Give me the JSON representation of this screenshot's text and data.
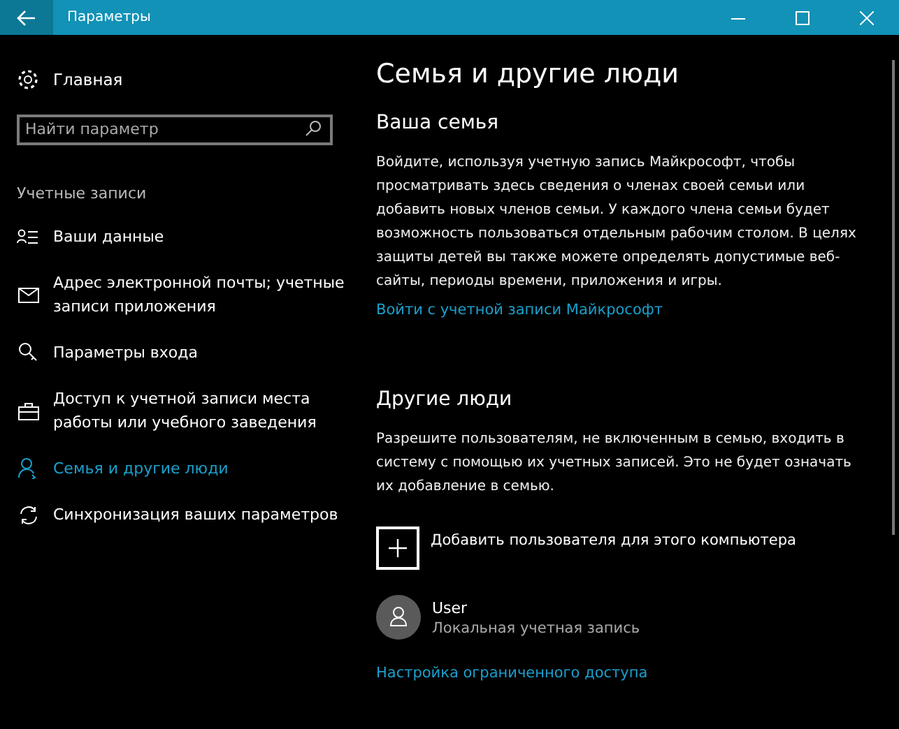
{
  "window": {
    "title": "Параметры"
  },
  "sidebar": {
    "home": "Главная",
    "search": {
      "placeholder": "Найти параметр"
    },
    "section": "Учетные записи",
    "items": [
      {
        "label": "Ваши данные",
        "kind": "card",
        "selected": false
      },
      {
        "label": "Адрес электронной почты; учетные записи приложения",
        "kind": "mail",
        "selected": false
      },
      {
        "label": "Параметры входа",
        "kind": "key",
        "selected": false
      },
      {
        "label": "Доступ к учетной записи места работы или учебного заведения",
        "kind": "briefcase",
        "selected": false
      },
      {
        "label": "Семья и другие люди",
        "kind": "person",
        "selected": true
      },
      {
        "label": "Синхронизация ваших параметров",
        "kind": "sync",
        "selected": false
      }
    ]
  },
  "page": {
    "title": "Семья и другие люди",
    "family": {
      "heading": "Ваша семья",
      "text": "Войдите, используя учетную запись Майкрософт, чтобы просматривать здесь сведения о членах своей семьи или добавить новых членов семьи. У каждого члена семьи будет возможность пользоваться отдельным рабочим столом. В целях защиты детей вы также можете определять допустимые веб-сайты, периоды времени, приложения и игры.",
      "link": "Войти с учетной записи Майкрософт"
    },
    "others": {
      "heading": "Другие люди",
      "text": "Разрешите пользователям, не включенным в семью, входить в систему с помощью их учетных записей. Это не будет означать их добавление в семью.",
      "add": "Добавить пользователя для этого компьютера",
      "users": [
        {
          "name": "User",
          "type": "Локальная учетная запись"
        }
      ],
      "link": "Настройка ограниченного доступа"
    }
  }
}
